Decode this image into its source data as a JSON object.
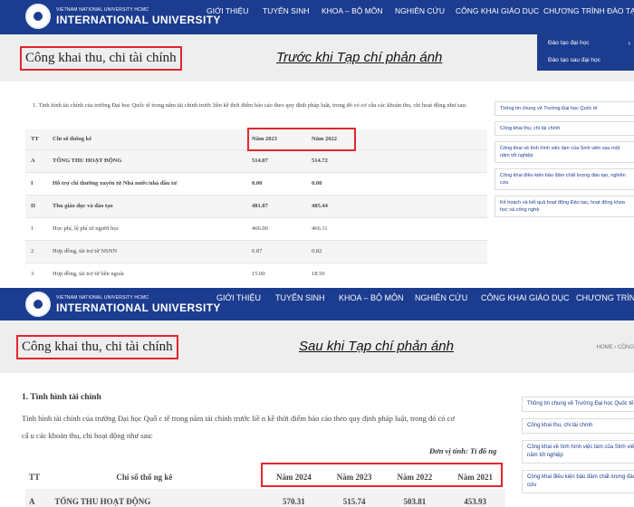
{
  "before": {
    "logo": {
      "small": "VIETNAM NATIONAL UNIVERSITY HCMC",
      "big": "INTERNATIONAL UNIVERSITY"
    },
    "nav": [
      "GIỚI THIỆU",
      "TUYỂN SINH",
      "KHOA – BỘ MÔN",
      "NGHIÊN CỨU",
      "CÔNG KHAI GIÁO DỤC",
      "CHƯƠNG TRÌNH ĐÀO TẠO"
    ],
    "dropdown": [
      "Đào tạo đại học",
      "Đào tạo sau đại học"
    ],
    "dropdown_arrow": "›",
    "page_title": "Công khai thu, chi tài chính",
    "caption": "Trước khi Tạp chí phản ánh",
    "intro": "1. Tình hình tài chính của trường Đại học Quốc tế trong năm tài chính trước liền kề thời điểm báo cáo theo quy định pháp luật, trong đó có cơ cấu các khoản thu, chi hoạt động như sau:",
    "table": {
      "headers": [
        "TT",
        "Chỉ số thống kê",
        "Năm 2023",
        "Năm 2022"
      ],
      "rows": [
        [
          "A",
          "TỔNG THU HOẠT ĐỘNG",
          "514.07",
          "514.72"
        ],
        [
          "I",
          "Hỗ trợ chi thường xuyên từ Nhà nước/nhà đầu tư",
          "0.00",
          "0.00"
        ],
        [
          "II",
          "Thu giáo dục và đào tạo",
          "481.87",
          "485.44"
        ],
        [
          "1",
          "Học phí, lệ phí từ người học",
          "466.00",
          "466.11"
        ],
        [
          "2",
          "Hợp đồng, tài trợ từ NSNN",
          "0.87",
          "0.82"
        ],
        [
          "3",
          "Hợp đồng, tài trợ từ bên ngoài",
          "15.00",
          "18.50"
        ]
      ]
    },
    "sidebar": [
      "Thông tin chung về Trường Đại học Quốc tế",
      "Công khai thu, chi tài chính",
      "Công khai về tình hình việc làm của Sinh viên sau một|năm tốt nghiệp",
      "Công khai điều kiện bảo đảm chất lượng đào tạo, nghiên|cứu",
      "Kế hoạch và kết quả hoạt động Đảo tạo, hoạt động khoa|học và công nghệ"
    ]
  },
  "after": {
    "logo": {
      "small": "VIETNAM NATIONAL UNIVERSITY HCMC",
      "big": "INTERNATIONAL UNIVERSITY"
    },
    "nav": [
      "GIỚI THIỆU",
      "TUYỂN SINH",
      "KHOA – BỘ MÔN",
      "NGHIÊN CỨU",
      "CÔNG KHAI GIÁO DỤC",
      "CHƯƠNG TRÌNH ĐÀO TẠO"
    ],
    "page_title": "Công khai thu, chi tài chính",
    "caption": "Sau khi Tạp chí phản ánh",
    "breadcrumb": "HOME  ›  CÔNG",
    "section_heading": "1. Tình hình tài chính",
    "intro_line1": "Tình hình tài chính của trường Đại học Quố c tế  trong năm tài chính trước liề n kề  thời điểm báo cáo theo quy định pháp luật, trong đó có cơ",
    "intro_line2": "cấ u các khoản thu, chi hoạt động như sau:",
    "unit": "Đơn vị tính: Tỉ đồ ng",
    "table": {
      "headers": [
        "TT",
        "Chỉ số  thố ng kê",
        "Năm 2024",
        "Năm 2023",
        "Năm 2022",
        "Năm 2021"
      ],
      "rows": [
        [
          "A",
          "TỔNG THU HOẠT ĐỘNG",
          "570.31",
          "515.74",
          "503.81",
          "453.93"
        ]
      ]
    },
    "sidebar": [
      "Thông tin chung về Trường Đại học Quốc tế",
      "Công khai thu, chi tài chính",
      "Công khai về tình hình việc làm của Sinh viên|năm tốt nghiệp",
      "Công khai điều kiện bảo đảm chất lượng đào|cứu"
    ]
  },
  "colors": {
    "nav_bg": "#1b3c8f",
    "highlight_red": "#e3262d",
    "title_band": "#eeeeee",
    "link_blue": "#1b3c8f"
  },
  "icons": [
    "university-emblem-icon",
    "chevron-right-icon"
  ]
}
